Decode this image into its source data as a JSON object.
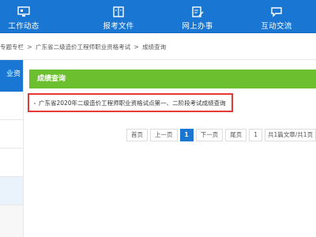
{
  "nav": {
    "items": [
      {
        "label": "工作动态",
        "icon": "monitor-icon"
      },
      {
        "label": "报考文件",
        "icon": "book-icon"
      },
      {
        "label": "网上办事",
        "icon": "edit-document-icon"
      },
      {
        "label": "互动交流",
        "icon": "chat-icon"
      }
    ]
  },
  "breadcrumb": {
    "parts": [
      "专题专栏",
      ">",
      "广东省二级造价工程师职业资格考试",
      ">",
      "成绩查询"
    ]
  },
  "sidebar": {
    "header_label": "业资"
  },
  "section": {
    "title": "成绩查询"
  },
  "list": {
    "items": [
      {
        "text": "广东省2020年二级造价工程师职业资格试点第一、二阶段考试成绩查询"
      }
    ]
  },
  "pagination": {
    "first": "首页",
    "prev": "上一页",
    "current": "1",
    "next": "下一页",
    "last": "尾页",
    "page_input": "1",
    "total": "共1篇文章/共1页"
  },
  "colors": {
    "nav_bg": "#1976d2",
    "title_bg": "#6cbf2f",
    "highlight": "#e53935",
    "current_page": "#1976d2"
  }
}
